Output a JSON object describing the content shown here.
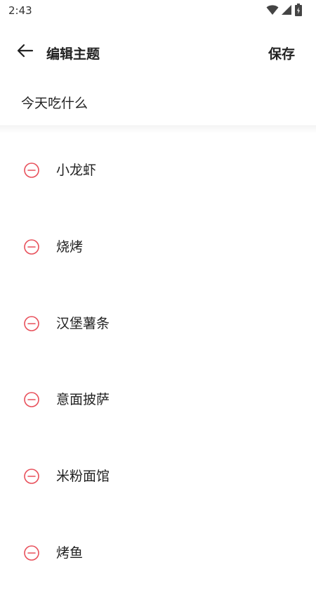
{
  "status_bar": {
    "time": "2:43",
    "icons": [
      "wifi-icon",
      "signal-icon",
      "battery-icon"
    ]
  },
  "header": {
    "back_icon": "arrow-left-icon",
    "title": "编辑主题",
    "save_label": "保存"
  },
  "topic": {
    "name": "今天吃什么"
  },
  "items": [
    {
      "label": "小龙虾"
    },
    {
      "label": "烧烤"
    },
    {
      "label": "汉堡薯条"
    },
    {
      "label": "意面披萨"
    },
    {
      "label": "米粉面馆"
    },
    {
      "label": "烤鱼"
    }
  ],
  "colors": {
    "remove_icon": "#e8505b",
    "text": "#222222"
  }
}
